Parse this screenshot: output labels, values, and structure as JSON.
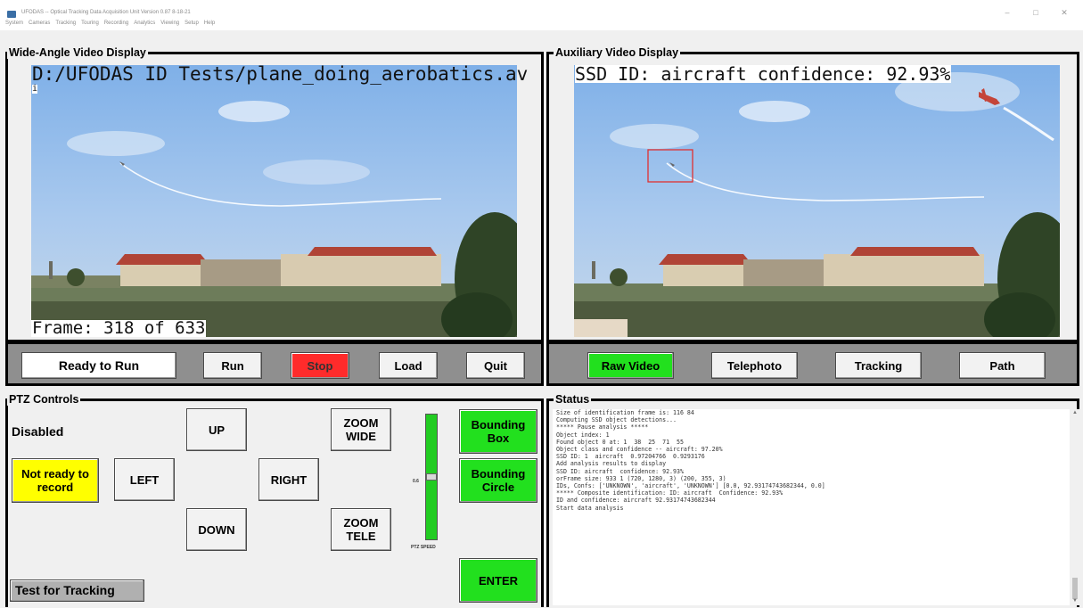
{
  "window": {
    "title": "UFODAS -- Optical Tracking Data Acquisition Unit   Version 0.87  8-18-21",
    "menu": [
      "System",
      "Cameras",
      "Tracking",
      "Touring",
      "Recording",
      "Analytics",
      "Viewing",
      "Setup",
      "Help"
    ],
    "controls": {
      "minimize": "–",
      "maximize": "□",
      "close": "✕"
    }
  },
  "wide_angle": {
    "label": "Wide-Angle Video Display",
    "filename": "D:/UFODAS ID Tests/plane_doing_aerobatics.av",
    "cursor": "i",
    "frame_text": "Frame: 318 of 633"
  },
  "auxiliary": {
    "label": "Auxiliary Video Display",
    "overlay_text": "SSD ID: aircraft   confidence: 92.93%"
  },
  "control_buttons": {
    "ready": "Ready to Run",
    "run": "Run",
    "stop": "Stop",
    "load": "Load",
    "quit": "Quit"
  },
  "aux_buttons": {
    "raw_video": "Raw Video",
    "telephoto": "Telephoto",
    "tracking": "Tracking",
    "path": "Path"
  },
  "ptz": {
    "label": "PTZ Controls",
    "status": "Disabled",
    "not_ready": "Not ready to record",
    "up": "UP",
    "down": "DOWN",
    "left": "LEFT",
    "right": "RIGHT",
    "zoom_wide": "ZOOM WIDE",
    "zoom_tele": "ZOOM TELE",
    "bounding_box": "Bounding Box",
    "bounding_circle": "Bounding Circle",
    "enter": "ENTER",
    "test_tracking": "Test for Tracking",
    "slider_value": "0.6",
    "slider_label": "PTZ SPEED",
    "slider_level": 0.5
  },
  "status": {
    "label": "Status",
    "lines": [
      "Size of identification frame is: 116 84",
      "Computing SSD object detections...",
      "",
      "***** Pause analysis *****",
      "Object index: 1",
      "Found object 0 at: 1  38  25  71  55",
      "Object class and confidence -- aircraft: 97.20%",
      "SSD ID: 1  aircraft  0.97204766  0.9293176",
      "Add analysis results to display",
      "SSD ID: aircraft  confidence: 92.93%",
      "orFrame size: 933 1 (720, 1280, 3) (200, 355, 3)",
      "IDs, Confs: ['UNKNOWN', 'aircraft', 'UNKNOWN'] [0.0, 92.93174743682344, 0.0]",
      "",
      "***** Composite identification: ID: aircraft  Confidence: 92.93%",
      "ID and confidence: aircraft 92.93174743682344",
      "Start data analysis"
    ]
  },
  "colors": {
    "stop": "#ff2b2b",
    "active_green": "#22e01e",
    "warning_yellow": "#ffff00",
    "detection_box": "#e03030"
  }
}
